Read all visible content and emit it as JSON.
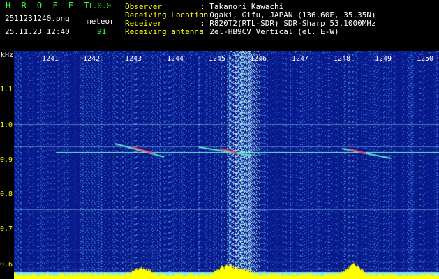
{
  "app": {
    "name": "H R O F F T",
    "version": "1.0.0"
  },
  "file": {
    "name": "2511231240.png",
    "datetime": "25.11.23 12:40"
  },
  "detection": {
    "label": "meteor",
    "count": "91"
  },
  "info": [
    {
      "label": "Observer",
      "value": ": Takanori Kawachi"
    },
    {
      "label": "Receiving Location",
      "value": ": Ogaki, Gifu, JAPAN (136.60E, 35.35N)"
    },
    {
      "label": "Receiver",
      "value": ": R820T2(RTL-SDR) SDR-Sharp 53.1000MHz"
    },
    {
      "label": "Receiving antenna",
      "value": ": 2el-HB9CV Vertical (el. E-W)"
    }
  ],
  "axis": {
    "y_unit": "kHz",
    "y_ticks": [
      "1.1",
      "1.0",
      "0.9",
      "0.8",
      "0.7",
      "0.6"
    ],
    "x_ticks": [
      "1241",
      "1242",
      "1243",
      "1244",
      "1245",
      "1246",
      "1247",
      "1248",
      "1249",
      "1250"
    ]
  },
  "colors": {
    "background": "#000000",
    "header_text": "#ffff00",
    "value_text": "#ffffff",
    "meteor_count": "#39ff39",
    "spectrum_bg": "#0a1f8c",
    "trace": "#6dffd8",
    "activity": "#ffff00"
  }
}
